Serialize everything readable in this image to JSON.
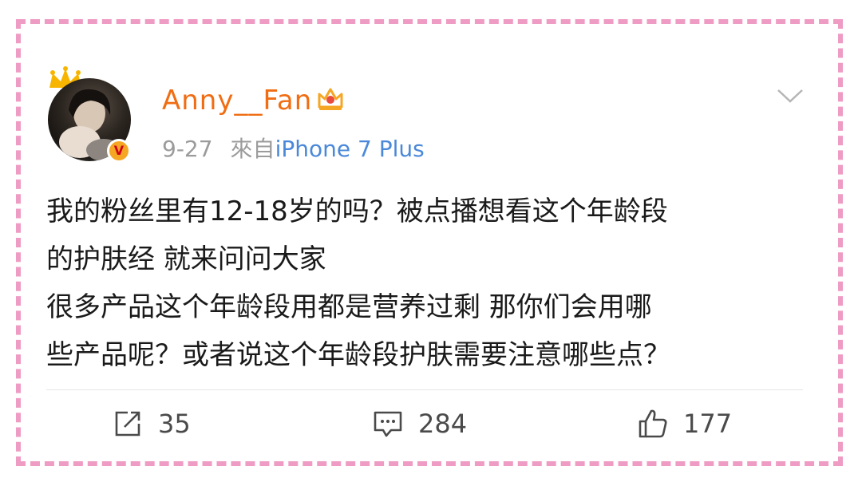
{
  "post": {
    "username": "Anny__Fan",
    "time": "9-27",
    "source_prefix": "來自",
    "source_device": "iPhone 7 Plus",
    "verified_badge": "V",
    "lines": [
      "我的粉丝里有12-18岁的吗？被点播想看这个年龄段",
      "的护肤经 就来问问大家",
      "很多产品这个年龄段用都是营养过剩 那你们会用哪",
      "些产品呢？或者说这个年龄段护肤需要注意哪些点？"
    ]
  },
  "actions": {
    "repost_count": "35",
    "comment_count": "284",
    "like_count": "177"
  },
  "icons": {
    "crown": "crown-icon",
    "vip": "vip-crown-icon",
    "menu": "chevron-down-icon",
    "repost": "share-icon",
    "comment": "comment-icon",
    "like": "thumbs-up-icon"
  },
  "colors": {
    "frame": "#ef9cc4",
    "username": "#f06d13",
    "link": "#4a88d9",
    "meta": "#9b9b9b",
    "text": "#1a1a1a"
  }
}
